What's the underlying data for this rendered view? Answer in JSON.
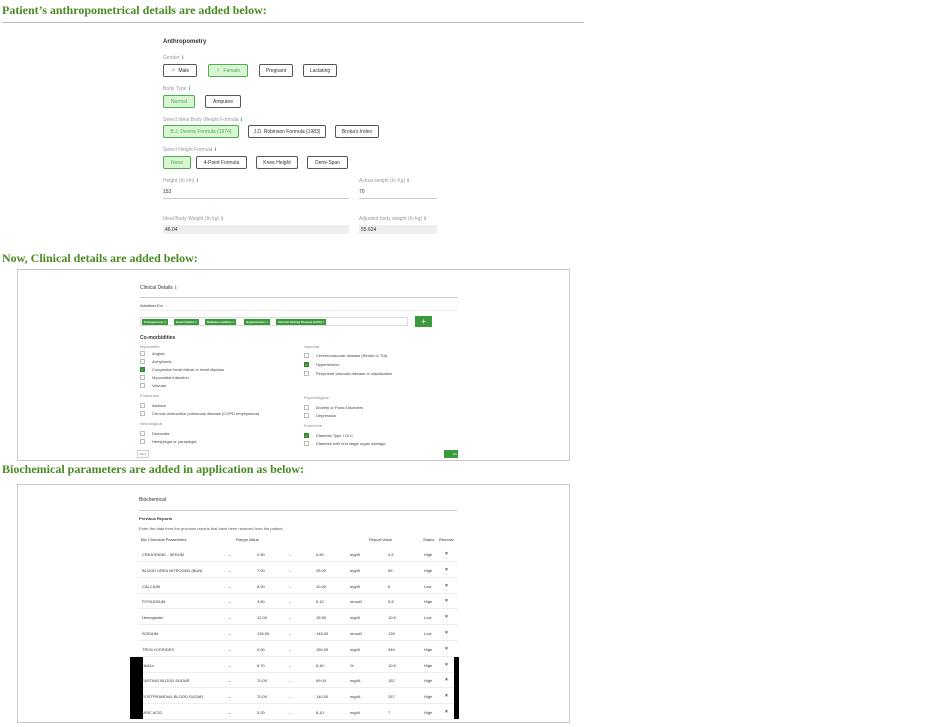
{
  "captions": {
    "anthropometry": "Patient’s anthropometrical details are added below:",
    "clinical": "Now, Clinical details are added below:",
    "biochemical": "Biochemical parameters are added in application as below:"
  },
  "anthropometry": {
    "title": "Anthropometry",
    "gender_label": "Gender",
    "gender_options": [
      {
        "label": "Male",
        "selected": false,
        "icon": "male-icon"
      },
      {
        "label": "Female",
        "selected": true,
        "icon": "female-icon"
      },
      {
        "label": "Pregnant",
        "selected": false
      },
      {
        "label": "Lactating",
        "selected": false
      }
    ],
    "body_type_label": "Body Type",
    "body_type_options": [
      {
        "label": "Normal",
        "selected": true
      },
      {
        "label": "Amputee",
        "selected": false
      }
    ],
    "ibw_label": "Select Ideal Body Weight Formula",
    "ibw_options": [
      {
        "label": "B.J. Devine Formula (1974)",
        "selected": true
      },
      {
        "label": "J.D. Robinson Formula (1983)",
        "selected": false
      },
      {
        "label": "Broka's Index",
        "selected": false
      }
    ],
    "height_formula_label": "Select Height Formula",
    "height_formula_options": [
      {
        "label": "None",
        "selected": true
      },
      {
        "label": "4-Point Formula",
        "selected": false
      },
      {
        "label": "Knee Height",
        "selected": false
      },
      {
        "label": "Demi-Span",
        "selected": false
      }
    ],
    "height_label": "Height (In cm)",
    "height_value": "153",
    "actual_weight_label": "Actual weight (In Kg)",
    "actual_weight_value": "70",
    "ideal_weight_label": "Ideal Body Weight (In kg)",
    "ideal_weight_value": "46.04",
    "adjusted_weight_label": "Adjusted body weight (In kg)",
    "adjusted_weight_value": "55.624",
    "accent": "#4caf50"
  },
  "clinical": {
    "title": "Clinical Details",
    "admitted_for_label": "Admitted For",
    "chips": [
      "Osteoporosis ×",
      "Heart Failure ×",
      "Diabetes mellitus ×",
      "Hypertension ×",
      "Chronic Kidney Disease (CKD) ×"
    ],
    "add_button": "+",
    "comorbidities_title": "Co-morbidities",
    "left_groups": [
      {
        "name": "Myocardial",
        "items": [
          {
            "label": "Angina",
            "checked": false
          },
          {
            "label": "Arrhythmia",
            "checked": false
          },
          {
            "label": "Congestive heart failure or heart disease",
            "checked": true
          },
          {
            "label": "Myocardial infarction",
            "checked": false
          },
          {
            "label": "Valvular",
            "checked": false
          }
        ]
      },
      {
        "name": "Pulmonary",
        "items": [
          {
            "label": "Asthma",
            "checked": false
          },
          {
            "label": "Chronic obstructive pulmonary disease (COPD emphysema)",
            "checked": false
          }
        ]
      },
      {
        "name": "Neurological",
        "items": [
          {
            "label": "Dementia",
            "checked": false
          },
          {
            "label": "Hemiplegia or paraplegia",
            "checked": false
          }
        ]
      }
    ],
    "right_groups": [
      {
        "name": "Vascular",
        "items": [
          {
            "label": "Cerebrovascular disease (Stroke or TIA)",
            "checked": false
          },
          {
            "label": "Hypertension",
            "checked": true
          },
          {
            "label": "Peripheral vascular disease or claudication",
            "checked": false
          }
        ]
      },
      {
        "name": "Psychological",
        "items": [
          {
            "label": "Anxiety or Panic Disorders",
            "checked": false
          },
          {
            "label": "Depression",
            "checked": false
          }
        ]
      },
      {
        "name": "Endocrine",
        "items": [
          {
            "label": "Diabetes Type I Or II",
            "checked": true
          },
          {
            "label": "Diabetes with end stage organ damage",
            "checked": false
          }
        ]
      }
    ],
    "back_button": "Back",
    "next_button": "Ne"
  },
  "biochemical": {
    "title": "Biochemical",
    "subtitle": "Previous Reports",
    "instructions": "Enter the data from the previous reports that have been received from the patient.",
    "headers": {
      "parameter": "Bio Chemical Parameters",
      "range": "Range Value",
      "report": "Report Value",
      "status": "Status",
      "remove": "Remove"
    },
    "rows": [
      {
        "name": "CREATININE - SERUM",
        "low": "0.50",
        "high": "0.80",
        "unit": "mg/dl",
        "value": "4.5",
        "status": "High"
      },
      {
        "name": "BLOOD UREA NITROGEN (BUN)",
        "low": "7.00",
        "high": "25.00",
        "unit": "mg/dl",
        "value": "69",
        "status": "High"
      },
      {
        "name": "CALCIUM",
        "low": "8.00",
        "high": "10.00",
        "unit": "mg/dl",
        "value": "6",
        "status": "Low"
      },
      {
        "name": "POTASSIUM",
        "low": "3.50",
        "high": "5.10",
        "unit": "mmol/l",
        "value": "5.8",
        "status": "High"
      },
      {
        "name": "Hemoglobin",
        "low": "12.00",
        "high": "15.50",
        "unit": "mg/dl",
        "value": "10.5",
        "status": "Low"
      },
      {
        "name": "SODIUM",
        "low": "136.00",
        "high": "145.00",
        "unit": "mmol/l",
        "value": "135",
        "status": "Low"
      },
      {
        "name": "TRIGLYCERIDES",
        "low": "0.00",
        "high": "150.00",
        "unit": "mg/dl",
        "value": "340",
        "status": "High"
      },
      {
        "name": "HbA1c",
        "low": "5.70",
        "high": "6.40",
        "unit": "%",
        "value": "10.5",
        "status": "High"
      },
      {
        "name": "FASTING BLOOD SUGAR",
        "low": "70.00",
        "high": "99.00",
        "unit": "mg/dL",
        "value": "152",
        "status": "High"
      },
      {
        "name": "POSTPRANDIAL BLOOD SUGAR",
        "low": "70.00",
        "high": "140.00",
        "unit": "mg/dL",
        "value": "267",
        "status": "High"
      },
      {
        "name": "URIC ACID",
        "low": "3.20",
        "high": "6.10",
        "unit": "mg/dl",
        "value": "7",
        "status": "High"
      }
    ],
    "dropdown_glyph": "⌄",
    "dash_glyph": "–",
    "remove_glyph": "×"
  }
}
